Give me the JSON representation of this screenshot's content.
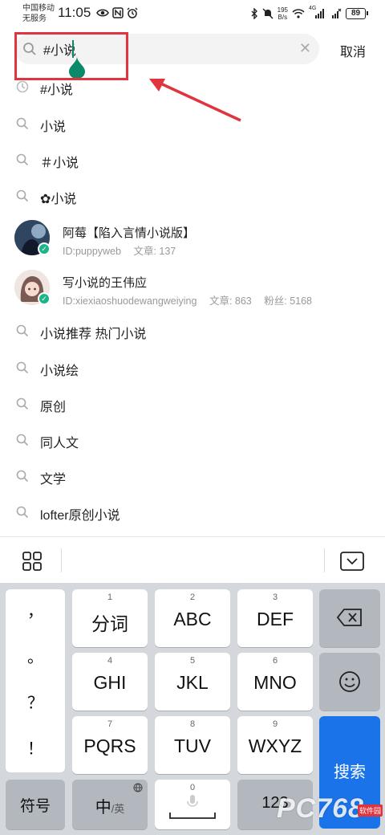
{
  "status_bar": {
    "carrier_line1": "中国移动",
    "carrier_line2": "无服务",
    "time": "11:05",
    "net_speed_value": "195",
    "net_speed_unit": "B/s",
    "network_type": "4G",
    "battery": "89"
  },
  "search": {
    "value": "#小说",
    "cancel_label": "取消"
  },
  "suggestions_top": [
    {
      "text": "#小说",
      "icon": "history-icon"
    },
    {
      "text": "小说",
      "icon": "search-icon"
    },
    {
      "text": "＃小说",
      "icon": "search-icon"
    },
    {
      "text": "✿小说",
      "icon": "search-icon"
    }
  ],
  "users": [
    {
      "name": "阿莓【陷入言情小说版】",
      "id": "ID:puppyweb",
      "articles": "文章: 137",
      "fans": ""
    },
    {
      "name": "写小说的王伟应",
      "id": "ID:xiexiaoshuodewangweiying",
      "articles": "文章: 863",
      "fans": "粉丝: 5168"
    }
  ],
  "suggestions_bottom": [
    {
      "text": "小说推荐 热门小说"
    },
    {
      "text": "小说绘"
    },
    {
      "text": "原创"
    },
    {
      "text": "同人文"
    },
    {
      "text": "文学"
    },
    {
      "text": "lofter原创小说"
    }
  ],
  "keyboard": {
    "punctuation": [
      "，",
      "。",
      "？",
      "！"
    ],
    "keys": [
      {
        "num": "1",
        "label": "分词"
      },
      {
        "num": "2",
        "label": "ABC"
      },
      {
        "num": "3",
        "label": "DEF"
      },
      {
        "num": "4",
        "label": "GHI"
      },
      {
        "num": "5",
        "label": "JKL"
      },
      {
        "num": "6",
        "label": "MNO"
      },
      {
        "num": "7",
        "label": "PQRS"
      },
      {
        "num": "8",
        "label": "TUV"
      },
      {
        "num": "9",
        "label": "WXYZ"
      }
    ],
    "symbols_label": "符号",
    "lang_main": "中",
    "lang_alt": "/英",
    "zero_num": "0",
    "num_label": "123",
    "search_label": "搜索"
  },
  "watermark": {
    "text": "PC768",
    "tag": "软件园"
  },
  "colors": {
    "accent_blue": "#1a73e8",
    "annotation_red": "#e0343f",
    "cursor_green": "#0a8a6b",
    "verified_green": "#1cb58a"
  }
}
